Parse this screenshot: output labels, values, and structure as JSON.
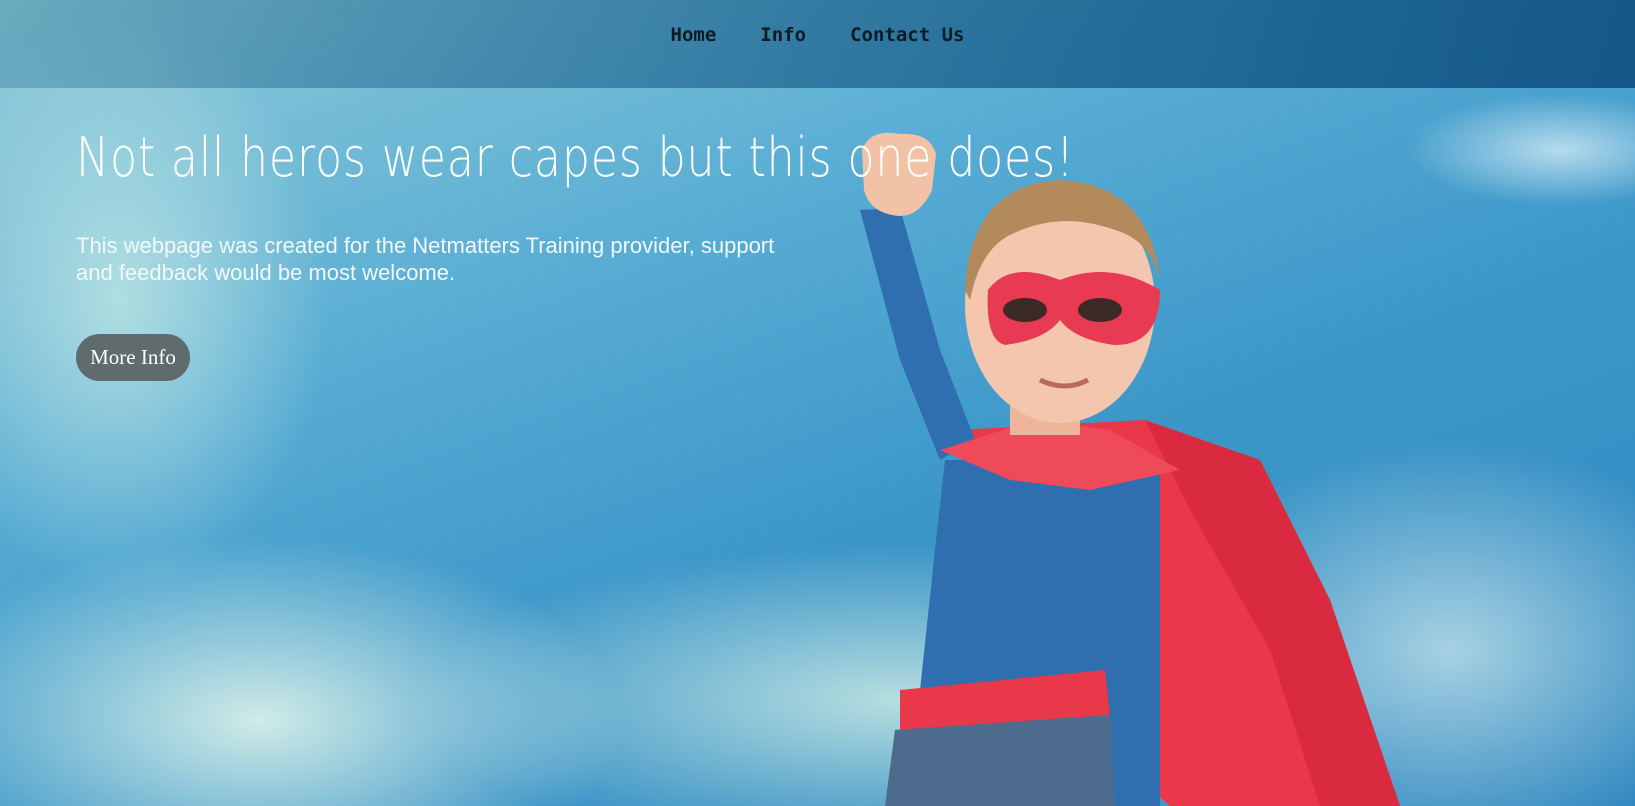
{
  "nav": {
    "items": [
      {
        "label": "Home"
      },
      {
        "label": "Info"
      },
      {
        "label": "Contact Us"
      }
    ]
  },
  "hero": {
    "headline": "Not all heros wear capes but this one does!",
    "subtext": "This webpage was created for the Netmatters Training provider, support and feedback would be most welcome.",
    "button_label": "More Info",
    "image": "superhero-boy-photo"
  },
  "colors": {
    "sky": "#3c97c9",
    "nav_bar": "#0a4b7d",
    "button": "#5f6b6c",
    "cape": "#e8384a",
    "suit": "#2f6fb0"
  }
}
